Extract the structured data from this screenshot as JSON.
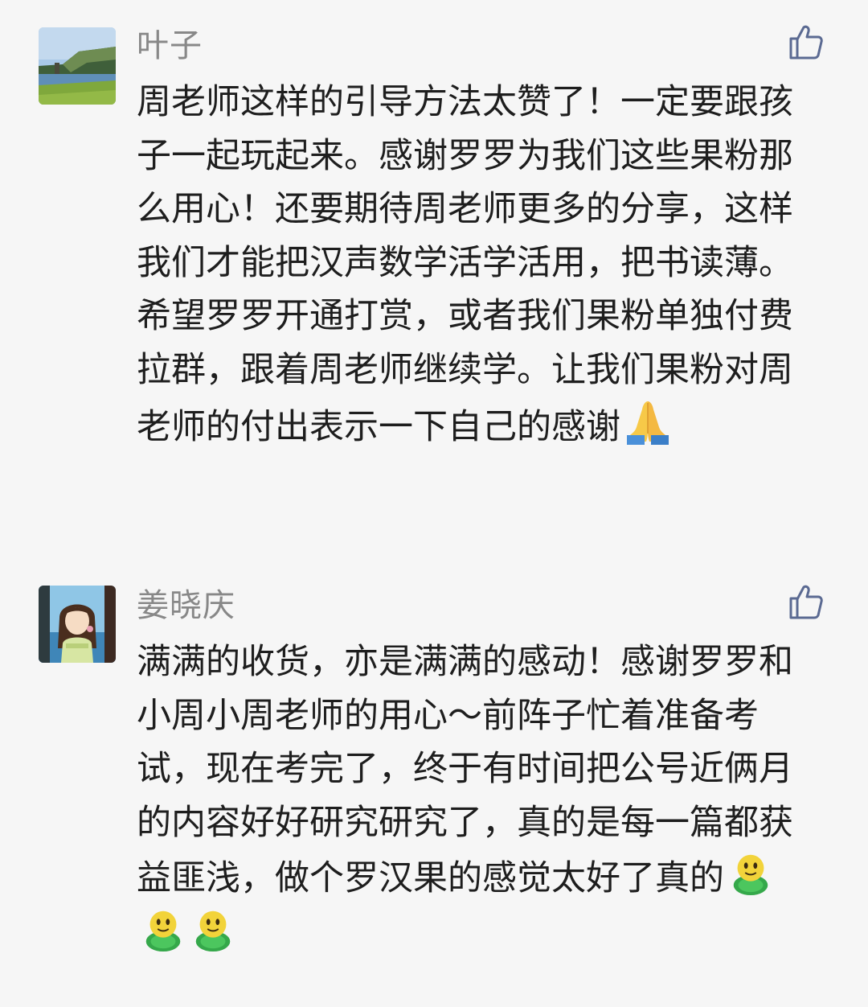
{
  "comments": [
    {
      "nickname": "叶子",
      "avatar_icon": "cliff-landscape-avatar",
      "like_icon": "thumbs-up-icon",
      "text": "周老师这样的引导方法太赞了！一定要跟孩子一起玩起来。感谢罗罗为我们这些果粉那么用心！还要期待周老师更多的分享，这样我们才能把汉声数学活学活用，把书读薄。希望罗罗开通打赏，或者我们果粉单独付费拉群，跟着周老师继续学。让我们果粉对周老师的付出表示一下自己的感谢",
      "emojis": [
        "folded-hands-emoji"
      ]
    },
    {
      "nickname": "姜晓庆",
      "avatar_icon": "anime-girl-avatar",
      "like_icon": "thumbs-up-icon",
      "text": "满满的收货，亦是满满的感动！感谢罗罗和小周小周老师的用心～前阵子忙着准备考试，现在考完了，终于有时间把公号近俩月的内容好好研究研究了，真的是每一篇都获益匪浅，做个罗汉果的感觉太好了真的",
      "emojis": [
        "green-sprout-emoji",
        "green-sprout-emoji",
        "green-sprout-emoji"
      ]
    }
  ],
  "colors": {
    "background": "#f6f6f6",
    "nickname": "#888888",
    "body_text": "#1e1e1e",
    "like_icon": "#5b6a92"
  }
}
